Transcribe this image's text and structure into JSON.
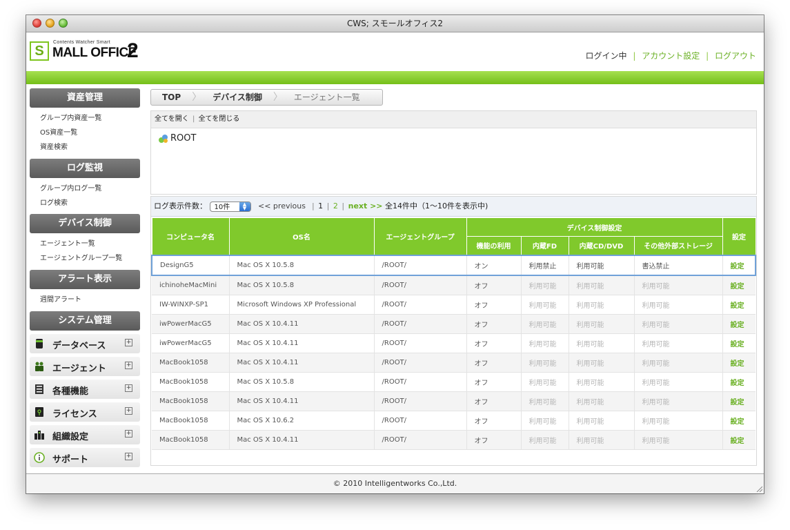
{
  "window": {
    "title": "CWS; スモールオフィス2"
  },
  "logo": {
    "small": "Contents Watcher Smart",
    "main": "MALL OFFICE",
    "letter": "S",
    "number": "2"
  },
  "header": {
    "status": "ログイン中",
    "account": "アカウント設定",
    "logout": "ログアウト"
  },
  "sidebar": {
    "assets": {
      "title": "資産管理",
      "items": [
        "グループ内資産一覧",
        "OS資産一覧",
        "資産検索"
      ]
    },
    "logs": {
      "title": "ログ監視",
      "items": [
        "グループ内ログ一覧",
        "ログ検索"
      ]
    },
    "device": {
      "title": "デバイス制御",
      "items": [
        "エージェント一覧",
        "エージェントグループ一覧"
      ]
    },
    "alert": {
      "title": "アラート表示",
      "items": [
        "週間アラート"
      ]
    },
    "system": {
      "title": "システム管理"
    },
    "accordion": [
      {
        "label": "データベース",
        "icon": "database-icon"
      },
      {
        "label": "エージェント",
        "icon": "agent-icon"
      },
      {
        "label": "各種機能",
        "icon": "list-icon"
      },
      {
        "label": "ライセンス",
        "icon": "license-icon"
      },
      {
        "label": "組織設定",
        "icon": "organization-icon"
      },
      {
        "label": "サポート",
        "icon": "info-icon"
      }
    ]
  },
  "breadcrumb": [
    "TOP",
    "デバイス制御",
    "エージェント一覧"
  ],
  "tree": {
    "open_all": "全てを開く",
    "close_all": "全てを閉じる",
    "root": "ROOT"
  },
  "pager": {
    "label": "ログ表示件数：",
    "per_page": "10件",
    "previous": "<< previous",
    "page1": "1",
    "page2": "2",
    "next": "next >>",
    "summary": "全14件中（1〜10件を表示中)"
  },
  "table": {
    "headers": {
      "computer": "コンピュータ名",
      "os": "OS名",
      "group": "エージェントグループ",
      "device": "デバイス制御設定",
      "settings": "設定"
    },
    "subheaders": {
      "function": "機能の利用",
      "fd": "内蔵FD",
      "cd": "内蔵CD/DVD",
      "storage": "その他外部ストレージ"
    },
    "rows": [
      {
        "computer": "DesignG5",
        "os": "Mac OS X 10.5.8",
        "group": "/ROOT/",
        "function": "オン",
        "fd": "利用禁止",
        "cd": "利用可能",
        "storage": "書込禁止",
        "action": "設定"
      },
      {
        "computer": "ichinoheMacMini",
        "os": "Mac OS X 10.5.8",
        "group": "/ROOT/",
        "function": "オフ",
        "fd": "利用可能",
        "cd": "利用可能",
        "storage": "利用可能",
        "action": "設定"
      },
      {
        "computer": "IW-WINXP-SP1",
        "os": "Microsoft Windows XP Professional",
        "group": "/ROOT/",
        "function": "オフ",
        "fd": "利用可能",
        "cd": "利用可能",
        "storage": "利用可能",
        "action": "設定"
      },
      {
        "computer": "iwPowerMacG5",
        "os": "Mac OS X 10.4.11",
        "group": "/ROOT/",
        "function": "オフ",
        "fd": "利用可能",
        "cd": "利用可能",
        "storage": "利用可能",
        "action": "設定"
      },
      {
        "computer": "iwPowerMacG5",
        "os": "Mac OS X 10.4.11",
        "group": "/ROOT/",
        "function": "オフ",
        "fd": "利用可能",
        "cd": "利用可能",
        "storage": "利用可能",
        "action": "設定"
      },
      {
        "computer": "MacBook1058",
        "os": "Mac OS X 10.4.11",
        "group": "/ROOT/",
        "function": "オフ",
        "fd": "利用可能",
        "cd": "利用可能",
        "storage": "利用可能",
        "action": "設定"
      },
      {
        "computer": "MacBook1058",
        "os": "Mac OS X 10.5.8",
        "group": "/ROOT/",
        "function": "オフ",
        "fd": "利用可能",
        "cd": "利用可能",
        "storage": "利用可能",
        "action": "設定"
      },
      {
        "computer": "MacBook1058",
        "os": "Mac OS X 10.4.11",
        "group": "/ROOT/",
        "function": "オフ",
        "fd": "利用可能",
        "cd": "利用可能",
        "storage": "利用可能",
        "action": "設定"
      },
      {
        "computer": "MacBook1058",
        "os": "Mac OS X 10.6.2",
        "group": "/ROOT/",
        "function": "オフ",
        "fd": "利用可能",
        "cd": "利用可能",
        "storage": "利用可能",
        "action": "設定"
      },
      {
        "computer": "MacBook1058",
        "os": "Mac OS X 10.4.11",
        "group": "/ROOT/",
        "function": "オフ",
        "fd": "利用可能",
        "cd": "利用可能",
        "storage": "利用可能",
        "action": "設定"
      }
    ]
  },
  "footer": {
    "copyright": "© 2010 Intelligentworks Co.,Ltd."
  },
  "colors": {
    "accent": "#80c92c",
    "link": "#6ab023",
    "selection": "#6fa1d8"
  }
}
